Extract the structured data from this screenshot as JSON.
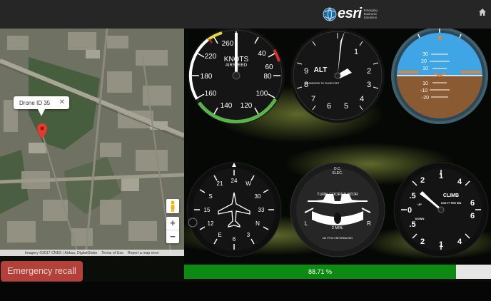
{
  "header": {
    "brand": "esri",
    "tagline": "Emerging Business Solutions",
    "home_icon": "home-icon"
  },
  "map": {
    "popup_title": "Drone ID 35",
    "popup_close": "✕",
    "zoom_in": "+",
    "zoom_out": "−",
    "attribution": [
      "Imagery ©2017 CNES / Airbus, DigitalGlobe",
      "Terms of Use",
      "Report a map error"
    ]
  },
  "instruments": {
    "airspeed": {
      "unit": "KNOTS",
      "caption": "AIRSPEED",
      "ticks": [
        "260",
        "40",
        "220",
        "60",
        "180",
        "80",
        "160",
        "100",
        "140",
        "120"
      ]
    },
    "altimeter": {
      "caption": "ALT",
      "subcaption": "CALIBRATED TO 20,000 FEET",
      "ticks": [
        "1",
        "2",
        "3",
        "4",
        "5",
        "6",
        "7",
        "8",
        "9"
      ]
    },
    "attitude": {
      "pitch_labels": [
        "30",
        "20",
        "10",
        "10",
        "-10",
        "-20"
      ]
    },
    "heading": {
      "ticks": [
        "21",
        "24",
        "W",
        "30",
        "33",
        "N",
        "3",
        "6",
        "E",
        "12",
        "15",
        "S"
      ]
    },
    "turn_coordinator": {
      "top_labels": [
        "D.C.",
        "ELEC."
      ],
      "caption": "TURN COORDINATOR",
      "left": "L",
      "right": "R",
      "sub": "2 MIN.",
      "footer": "NO PITCH INFORMATION"
    },
    "vsi": {
      "caption": "CLIMB",
      "up": "UP",
      "down": "DOWN",
      "sub": "1000 FT PER MIN",
      "ticks_left": [
        "2",
        ".5",
        "0",
        ".5",
        "2"
      ],
      "ticks_right": [
        "4",
        "6",
        "6",
        "4"
      ],
      "ticks_top": [
        "1"
      ],
      "ticks_bottom": [
        "1"
      ]
    }
  },
  "actions": {
    "emergency_recall": "Emergency recall"
  },
  "progress": {
    "value": 0.8871,
    "label": "88.71 %"
  }
}
